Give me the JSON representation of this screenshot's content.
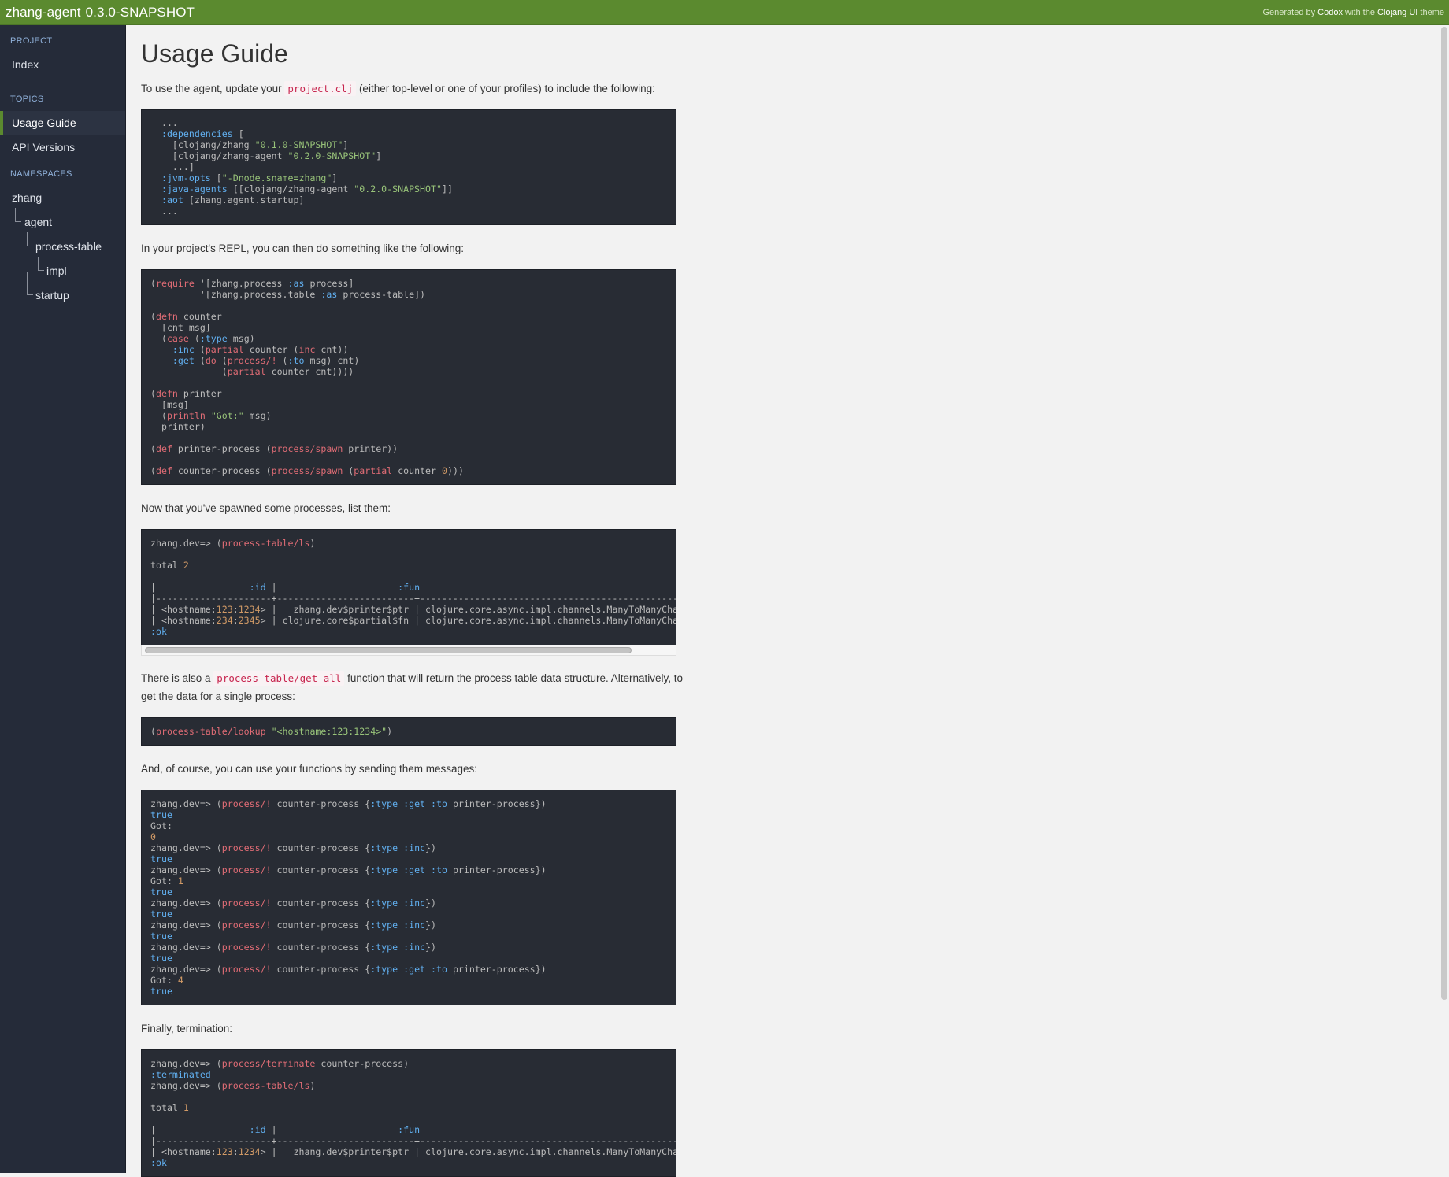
{
  "topbar": {
    "project": "zhang-agent",
    "version": "0.3.0-SNAPSHOT",
    "credit_prefix": "Generated by ",
    "credit_codox": "Codox",
    "credit_mid": " with the ",
    "credit_theme": "Clojang UI",
    "credit_suffix": " theme"
  },
  "sidebar": {
    "project_title": "PROJECT",
    "index": "Index",
    "topics_title": "TOPICS",
    "topics": [
      "Usage Guide",
      "API Versions"
    ],
    "current_topic": "Usage Guide",
    "namespaces_title": "NAMESPACES",
    "namespaces": [
      "zhang",
      "agent",
      "process-table",
      "impl",
      "startup"
    ]
  },
  "content": {
    "title": "Usage Guide",
    "p1_a": "To use the agent, update your ",
    "p1_code": "project.clj",
    "p1_b": " (either top-level or one of your profiles) to include the following:",
    "p2": "In your project's REPL, you can then do something like the following:",
    "p3": "Now that you've spawned some processes, list them:",
    "p4_a": "There is also a ",
    "p4_code": "process-table/get-all",
    "p4_b": " function that will return the process table data structure. Alternatively, to get the data for a single process:",
    "p5": "And, of course, you can use your functions by sending them messages:",
    "p6": "Finally, termination:"
  }
}
